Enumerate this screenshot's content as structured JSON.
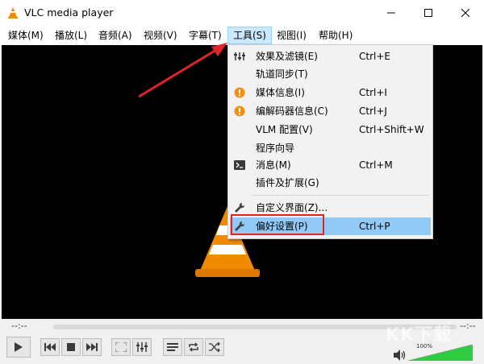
{
  "window": {
    "title": "VLC media player",
    "icons": {
      "app": "vlc-cone-icon",
      "minimize": "minimize-icon",
      "maximize": "maximize-icon",
      "close": "close-icon"
    }
  },
  "menubar": {
    "items": [
      {
        "label": "媒体(M)"
      },
      {
        "label": "播放(L)"
      },
      {
        "label": "音频(A)"
      },
      {
        "label": "视频(V)"
      },
      {
        "label": "字幕(T)"
      },
      {
        "label": "工具(S)",
        "state": "open"
      },
      {
        "label": "视图(I)"
      },
      {
        "label": "帮助(H)"
      }
    ]
  },
  "tools_menu": {
    "items": [
      {
        "label": "效果及滤镜(E)",
        "shortcut": "Ctrl+E",
        "icon": "equalizer-icon"
      },
      {
        "label": "轨道同步(T)",
        "shortcut": "",
        "icon": ""
      },
      {
        "label": "媒体信息(I)",
        "shortcut": "Ctrl+I",
        "icon": "info-icon"
      },
      {
        "label": "编解码器信息(C)",
        "shortcut": "Ctrl+J",
        "icon": "info-icon"
      },
      {
        "label": "VLM 配置(V)",
        "shortcut": "Ctrl+Shift+W",
        "icon": ""
      },
      {
        "label": "程序向导",
        "shortcut": "",
        "icon": ""
      },
      {
        "label": "消息(M)",
        "shortcut": "Ctrl+M",
        "icon": "terminal-icon"
      },
      {
        "label": "插件及扩展(G)",
        "shortcut": "",
        "icon": ""
      },
      {
        "label": "自定义界面(Z)...",
        "shortcut": "",
        "icon": "wrench-icon"
      },
      {
        "label": "偏好设置(P)",
        "shortcut": "Ctrl+P",
        "icon": "wrench-icon",
        "state": "highlighted"
      }
    ]
  },
  "controls": {
    "time_elapsed": "--:--",
    "time_total": "--:--",
    "volume_percent": "100%",
    "volume_level": 1.0,
    "buttons": [
      "play-icon",
      "previous-icon",
      "stop-icon",
      "next-icon",
      "fullscreen-icon",
      "extended-settings-icon",
      "playlist-icon",
      "loop-icon",
      "shuffle-icon"
    ]
  },
  "colors": {
    "menu_open_bg": "#cce8ff",
    "menu_highlight_bg": "#91c9f7",
    "annotation_red": "#e0242c",
    "cone_orange": "#f08a00",
    "info_orange": "#f29111",
    "volume_green": "#2ecc40"
  },
  "watermark": "KK下载"
}
